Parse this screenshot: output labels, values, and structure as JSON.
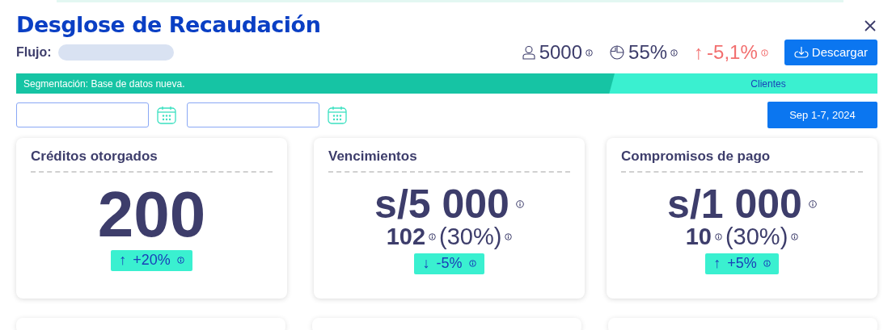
{
  "title": "Desglose de Recaudación",
  "flow": {
    "label": "Flujo:"
  },
  "stats": [
    {
      "kind": "users",
      "value": "5000"
    },
    {
      "kind": "share",
      "value": "55%"
    },
    {
      "kind": "change",
      "value": "-5,1%",
      "arrow": "↑"
    }
  ],
  "download_button": "Descargar",
  "segment_bar": {
    "label": "Segmentación: Base de datos nueva.",
    "tag": "Clientes"
  },
  "date_range_button": "Sep 1-7, 2024",
  "cards": [
    {
      "title": "Créditos otorgados",
      "kind": "count",
      "value": "200",
      "trend": {
        "arrow": "↑",
        "text": "+20%"
      }
    },
    {
      "title": "Vencimientos",
      "kind": "amount",
      "value": "s/5 000",
      "count": "102",
      "share": "(30%)",
      "trend": {
        "arrow": "↓",
        "text": "-5%"
      }
    },
    {
      "title": "Compromisos de pago",
      "kind": "amount",
      "value": "s/1 000",
      "count": "10",
      "share": "(30%)",
      "trend": {
        "arrow": "↑",
        "text": "+5%"
      }
    }
  ]
}
